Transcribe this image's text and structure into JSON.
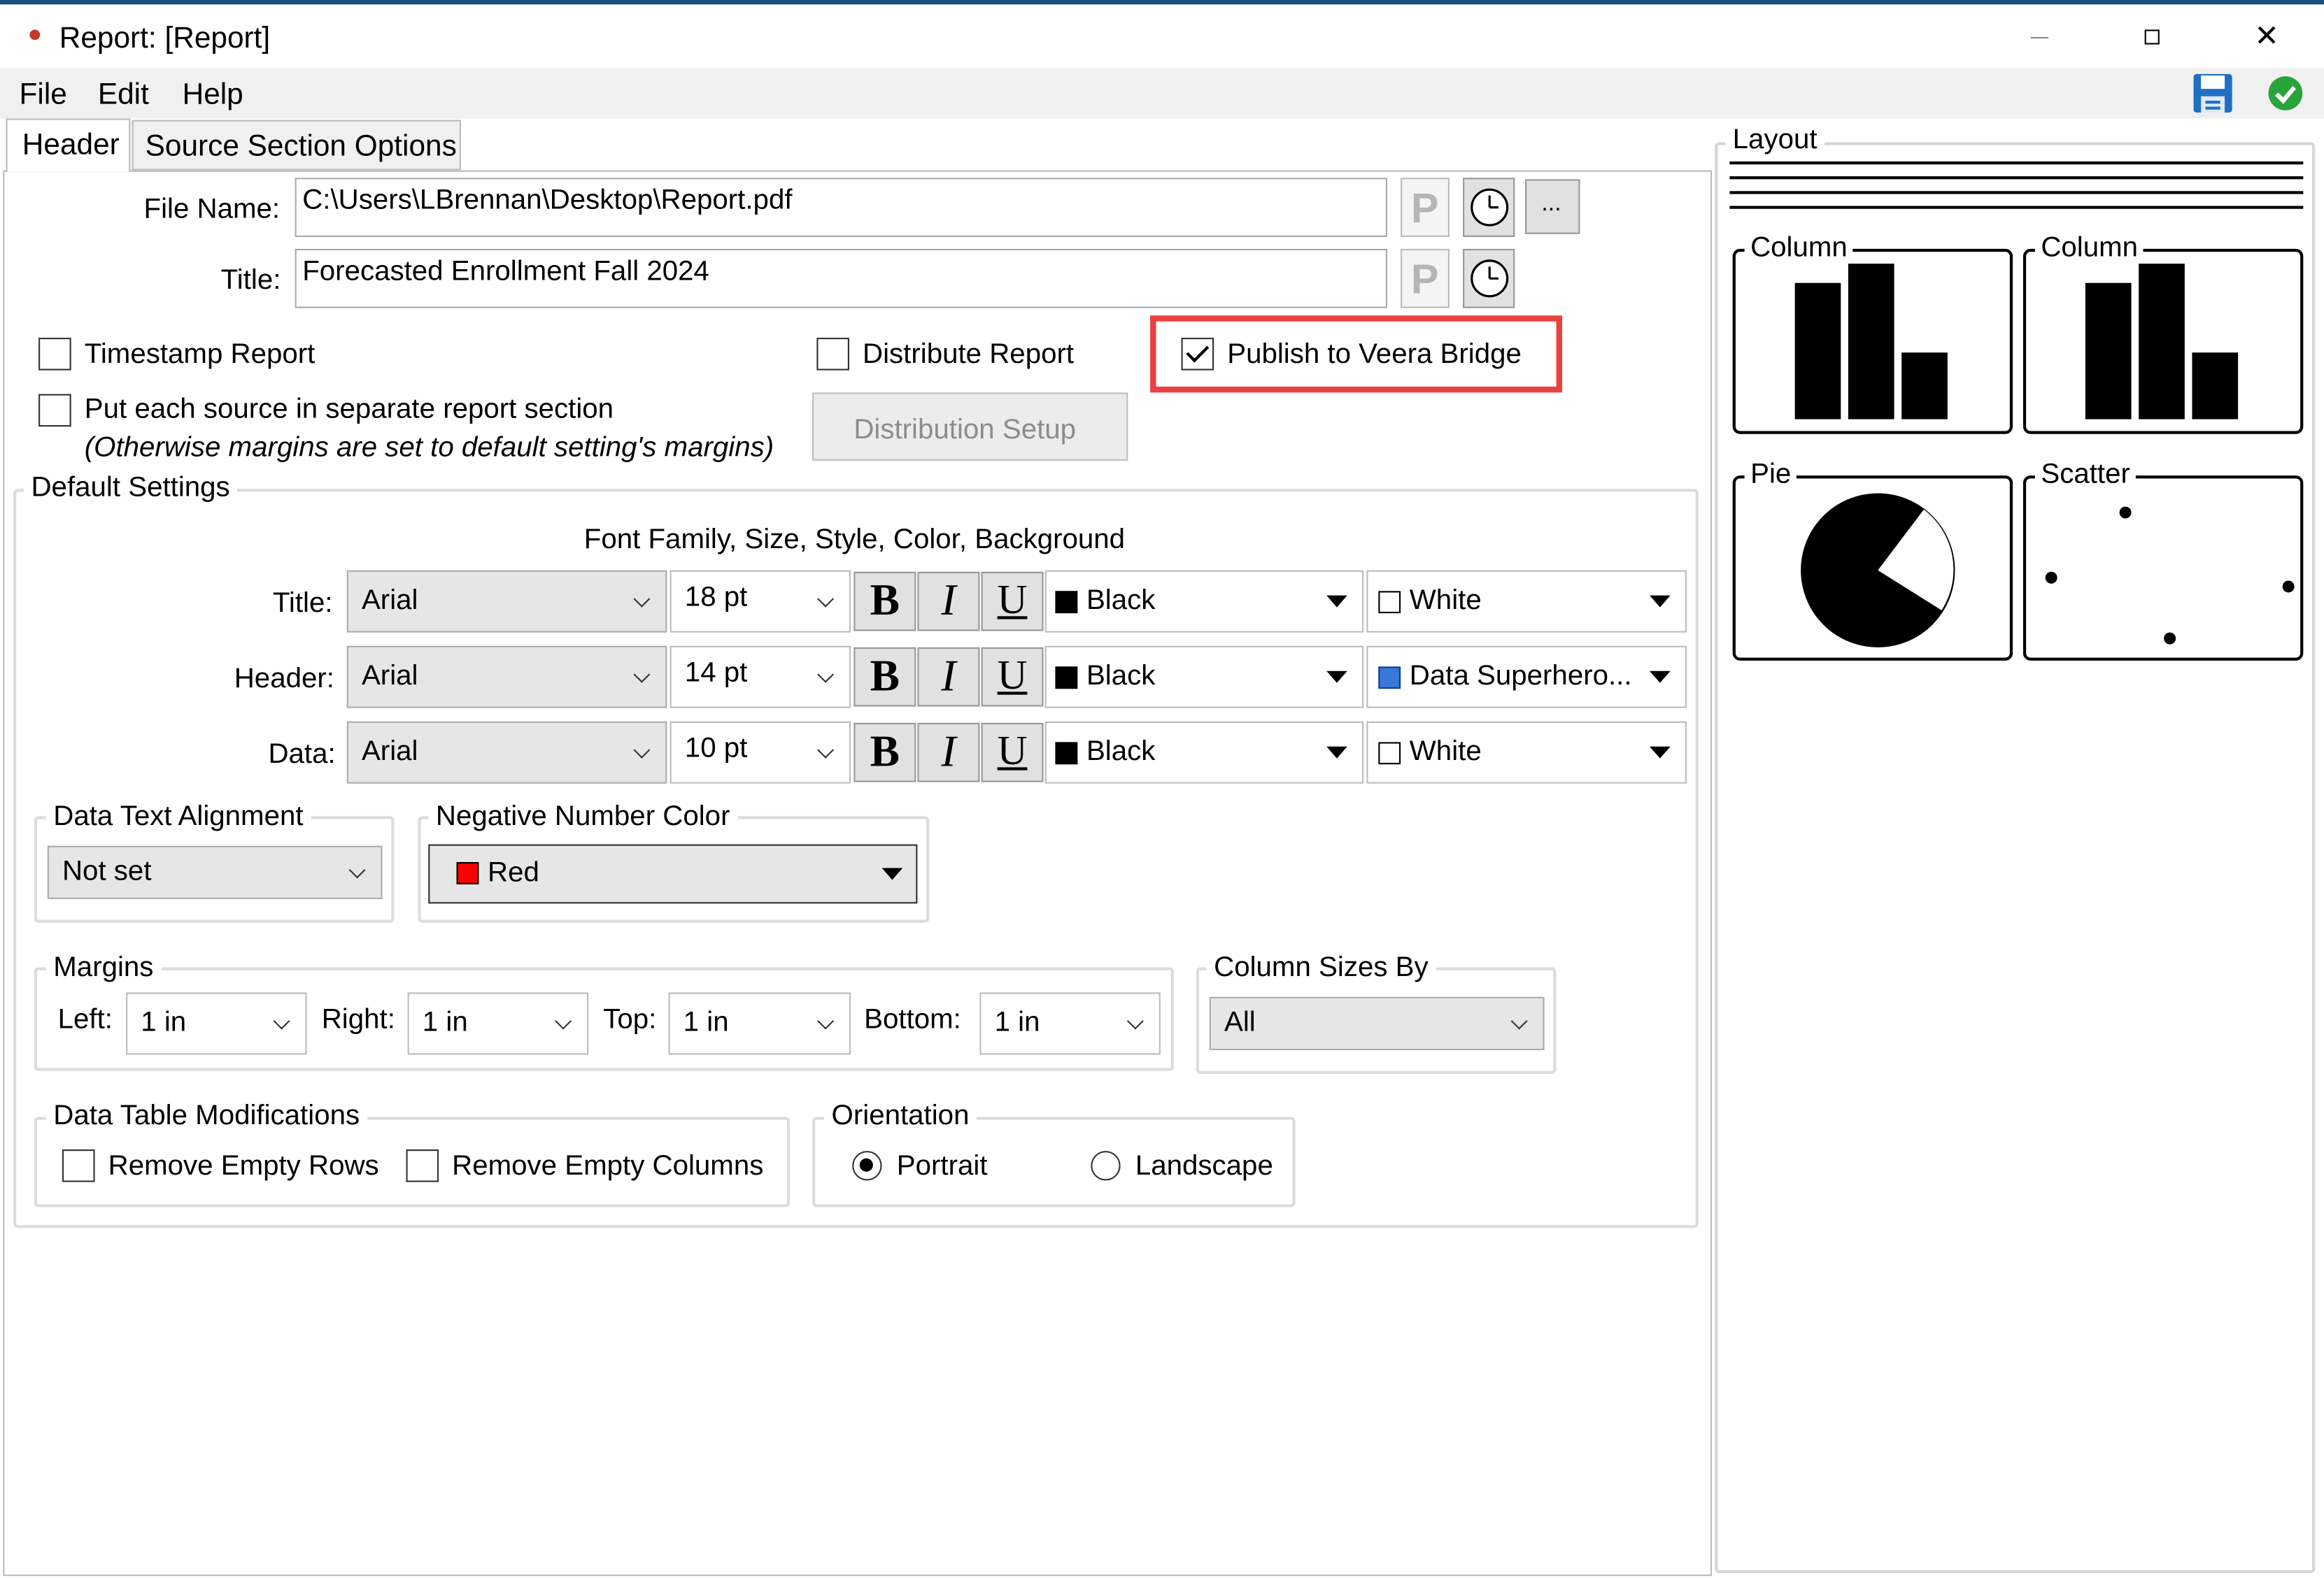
{
  "window": {
    "title": "Report: [Report]"
  },
  "menu": {
    "file": "File",
    "edit": "Edit",
    "help": "Help"
  },
  "tabs": {
    "header": "Header",
    "source_options": "Source Section Options"
  },
  "file_name": {
    "label": "File Name:",
    "value": "C:\\Users\\LBrennan\\Desktop\\Report.pdf",
    "browse": "..."
  },
  "title_field": {
    "label": "Title:",
    "value": "Forecasted Enrollment Fall 2024"
  },
  "param_glyph": "P",
  "options": {
    "timestamp": "Timestamp Report",
    "separate_section": "Put each source in separate report section",
    "separate_note": "(Otherwise margins are set to default setting's margins)",
    "distribute": "Distribute Report",
    "distribution_setup": "Distribution Setup",
    "publish": "Publish to Veera Bridge"
  },
  "defaults": {
    "legend": "Default Settings",
    "font_heading": "Font Family, Size, Style, Color, Background",
    "bold": "B",
    "italic": "I",
    "underline": "U",
    "rows": [
      {
        "label": "Title:",
        "font": "Arial",
        "size": "18 pt",
        "color": "Black",
        "color_hex": "#000000",
        "bg": "White",
        "bg_hex": "#ffffff"
      },
      {
        "label": "Header:",
        "font": "Arial",
        "size": "14 pt",
        "color": "Black",
        "color_hex": "#000000",
        "bg": "Data Superhero...",
        "bg_hex": "#3a78d8"
      },
      {
        "label": "Data:",
        "font": "Arial",
        "size": "10 pt",
        "color": "Black",
        "color_hex": "#000000",
        "bg": "White",
        "bg_hex": "#ffffff"
      }
    ]
  },
  "alignment": {
    "legend": "Data Text Alignment",
    "value": "Not set"
  },
  "negative": {
    "legend": "Negative Number Color",
    "value": "Red",
    "hex": "#ff0000"
  },
  "margins": {
    "legend": "Margins",
    "left_label": "Left:",
    "left": "1 in",
    "right_label": "Right:",
    "right": "1 in",
    "top_label": "Top:",
    "top": "1 in",
    "bottom_label": "Bottom:",
    "bottom": "1 in"
  },
  "column_sizes": {
    "legend": "Column Sizes By",
    "value": "All"
  },
  "table_mods": {
    "legend": "Data Table Modifications",
    "remove_rows": "Remove Empty Rows",
    "remove_cols": "Remove Empty Columns"
  },
  "orientation": {
    "legend": "Orientation",
    "portrait": "Portrait",
    "landscape": "Landscape"
  },
  "layout": {
    "legend": "Layout",
    "column1": "Column",
    "column2": "Column",
    "pie": "Pie",
    "scatter": "Scatter"
  },
  "colors": {
    "highlight": "#e8413f",
    "accent": "#1f7ad6",
    "ok": "#2aa33b"
  }
}
